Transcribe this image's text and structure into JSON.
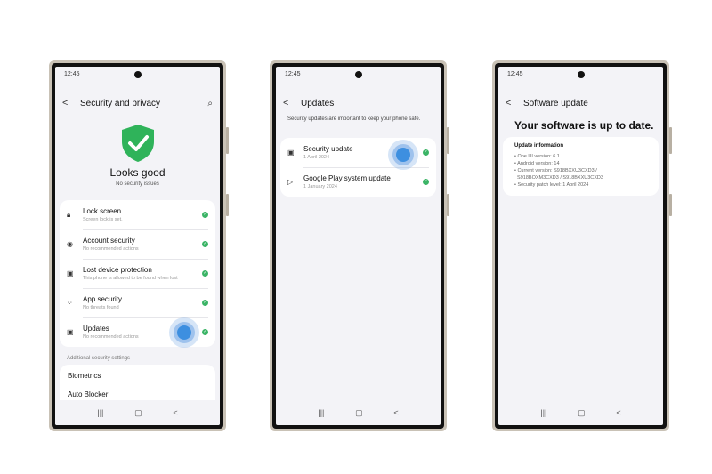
{
  "status_time": "12:45",
  "nav": {
    "recents": "|||",
    "home": "▢",
    "back": "<"
  },
  "phone1": {
    "title": "Security and privacy",
    "status_title": "Looks good",
    "status_sub": "No security issues",
    "items": [
      {
        "title": "Lock screen",
        "sub": "Screen lock is set.",
        "icon": "lock-icon",
        "glyph": "🔒︎"
      },
      {
        "title": "Account security",
        "sub": "No recommended actions",
        "icon": "account-icon",
        "glyph": "◉"
      },
      {
        "title": "Lost device protection",
        "sub": "This phone is allowed to be found when lost",
        "icon": "find-device-icon",
        "glyph": "▣"
      },
      {
        "title": "App security",
        "sub": "No threats found",
        "icon": "apps-icon",
        "glyph": "⁘"
      },
      {
        "title": "Updates",
        "sub": "No recommended actions",
        "icon": "update-icon",
        "glyph": "▣"
      }
    ],
    "section_label": "Additional security settings",
    "extra": [
      "Biometrics",
      "Auto Blocker"
    ]
  },
  "phone2": {
    "title": "Updates",
    "description": "Security updates are important to keep your phone safe.",
    "items": [
      {
        "title": "Security update",
        "sub": "1 April 2024",
        "icon": "security-update-icon",
        "glyph": "▣"
      },
      {
        "title": "Google Play system update",
        "sub": "1 January 2024",
        "icon": "google-play-icon",
        "glyph": "▷"
      }
    ]
  },
  "phone3": {
    "title": "Software update",
    "headline": "Your software is up to date.",
    "info_title": "Update information",
    "info_lines": [
      "• One UI version: 6.1",
      "• Android version: 14",
      "• Current version: S918BXXU3CXD3 /",
      "  S918BOXM3CXD3 / S918BXXU3CXD3",
      "• Security patch level: 1 April 2024"
    ]
  },
  "colors": {
    "ok_green": "#3bb466",
    "shield_green": "#2fb35a",
    "touch_blue": "#3d8fe0"
  }
}
